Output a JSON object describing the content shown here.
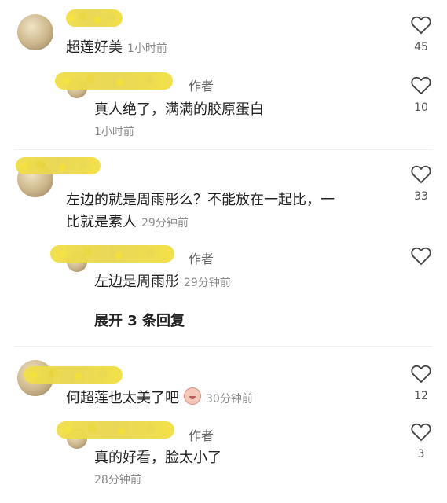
{
  "comments": [
    {
      "text": "超莲好美",
      "time": "1小时前",
      "likes": "45",
      "reply": {
        "author_tag": "作者",
        "text": "真人绝了，满满的胶原蛋白",
        "time": "1小时前",
        "likes": "10"
      }
    },
    {
      "text_line1": "左边的就是周雨彤么？不能放在一起比，一",
      "text_line2": "比就是素人",
      "time": "29分钟前",
      "likes": "33",
      "reply": {
        "author_tag": "作者",
        "text": "左边是周雨彤",
        "time": "29分钟前",
        "likes": ""
      },
      "expand_label": "展开 3 条回复"
    },
    {
      "text": "何超莲也太美了吧",
      "time": "30分钟前",
      "likes": "12",
      "reply": {
        "author_tag": "作者",
        "text": "真的好看，脸太小了",
        "time": "28分钟前",
        "likes": "3"
      }
    }
  ],
  "icons": {
    "like": "heart-outline-icon",
    "emoji": "face-emoji-icon"
  },
  "colors": {
    "text": "#222222",
    "muted": "#8b8b8b",
    "mask_yellow": "#f1df45"
  }
}
